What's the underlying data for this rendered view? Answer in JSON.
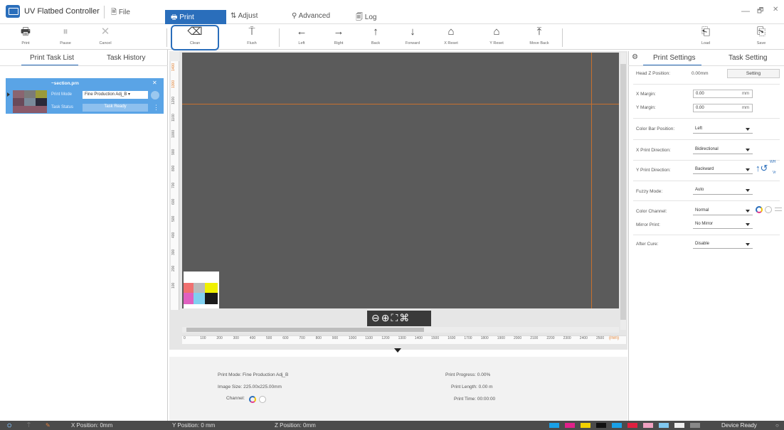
{
  "app": {
    "title": "UV Flatbed Controller"
  },
  "menu": {
    "file": "File",
    "tabs": [
      "Print",
      "Adjust",
      "Advanced",
      "Log"
    ]
  },
  "window": {
    "minimize": "—",
    "maximize": "🗗",
    "close": "✕"
  },
  "toolbar": {
    "print": "Print",
    "pause": "Pause",
    "cancel": "Cancel",
    "clean": "Clean",
    "flush": "Flush",
    "left": "Left",
    "right": "Right",
    "back": "Back",
    "forward": "Forward",
    "x_reset": "X Reset",
    "y_reset": "Y Reset",
    "move_back": "Move Back",
    "load": "Load",
    "save": "Save"
  },
  "left_panel": {
    "tabs": [
      "Print Task List",
      "Task History"
    ],
    "task": {
      "name": "~section.prn",
      "print_mode_label": "Print Mode",
      "print_mode_value": "Fine Production Adj_B",
      "task_status_label": "Task Status",
      "task_status_value": "Task Ready"
    }
  },
  "ruler": {
    "bottom_ticks": [
      "0",
      "100",
      "200",
      "300",
      "400",
      "500",
      "600",
      "700",
      "800",
      "900",
      "1000",
      "1100",
      "1200",
      "1300",
      "1400",
      "1500",
      "1600",
      "1700",
      "1800",
      "1900",
      "2000",
      "2100",
      "2200",
      "2300",
      "2400",
      "2500"
    ],
    "unit": "(mm)",
    "left_ticks": [
      "1400",
      "1300",
      "1200",
      "1100",
      "1000",
      "900",
      "800",
      "700",
      "600",
      "500",
      "400",
      "300",
      "200",
      "100"
    ]
  },
  "bottom_info": {
    "print_mode": "Print Mode: Fine Production Adj_B",
    "image_size": "Image Size: 225.00x225.00mm",
    "channel": "Channel:",
    "print_progress": "Print Progress: 0.00%",
    "print_length": "Print Length: 0.00 m",
    "print_time": "Print Time: 00:00:00"
  },
  "right_panel": {
    "tabs": [
      "Print Settings",
      "Task Setting"
    ],
    "head_z_label": "Head Z Position:",
    "head_z_value": "0.00mm",
    "setting_button": "Setting",
    "x_margin_label": "X Margin:",
    "x_margin_value": "0.00",
    "y_margin_label": "Y Margin:",
    "y_margin_value": "0.00",
    "unit": "mm",
    "color_bar_label": "Color Bar Position:",
    "color_bar_value": "Left",
    "x_dir_label": "X Print Direction:",
    "x_dir_value": "Bidirectional",
    "y_dir_label": "Y Print Direction:",
    "y_dir_value": "Backward",
    "y_dir_icon_text1": "WH",
    "y_dir_icon_text2": "Vr",
    "fuzzy_label": "Fuzzy Mode:",
    "fuzzy_value": "Auto",
    "color_channel_label": "Color Channel:",
    "color_channel_value": "Normal",
    "mirror_label": "Mirror Print:",
    "mirror_value": "No Mirror",
    "after_cure_label": "After Cure:",
    "after_cure_value": "Disable"
  },
  "status_bar": {
    "x_position": "X Position: 0mm",
    "y_position": "Y Position: 0 mm",
    "z_position": "Z Position: 0mm",
    "device_status": "Device Ready"
  },
  "colors": {
    "accent": "#2a6ebb",
    "ink_slots": [
      "#1aa0e6",
      "#e0208a",
      "#f2d000",
      "#111111",
      "#1aa0e6",
      "#e02040",
      "#f0a0c0",
      "#80c8f0",
      "#f0f0f0",
      "#888888"
    ]
  }
}
